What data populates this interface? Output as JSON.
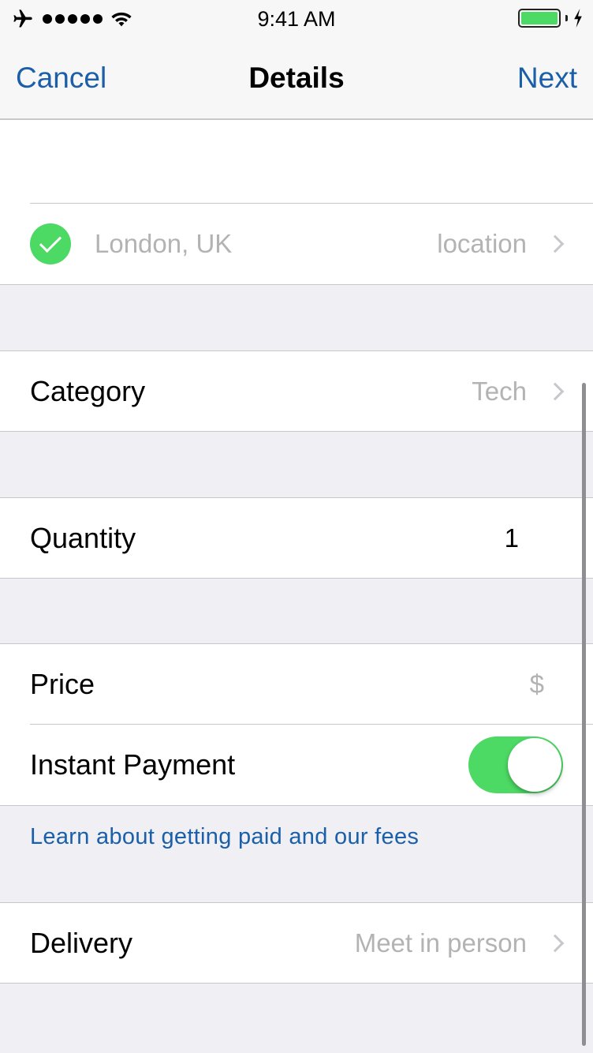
{
  "status_bar": {
    "time": "9:41 AM",
    "left_icons": [
      "airplane-icon",
      "signal-dots-icon",
      "wifi-icon"
    ],
    "right_icons": [
      "battery-icon",
      "charging-bolt-icon"
    ],
    "battery_level": 1.0,
    "battery_color": "#4cd964"
  },
  "nav": {
    "cancel_label": "Cancel",
    "title": "Details",
    "next_label": "Next",
    "accent_color": "#1a5fa8"
  },
  "location": {
    "text": "London, UK",
    "action_label": "location",
    "verified": true
  },
  "category": {
    "label": "Category",
    "value": "Tech"
  },
  "quantity": {
    "label": "Quantity",
    "value": "1"
  },
  "price": {
    "label": "Price",
    "placeholder": "$"
  },
  "instant_payment": {
    "label": "Instant Payment",
    "enabled": true
  },
  "fees_link": "Learn about getting paid and our fees",
  "delivery": {
    "label": "Delivery",
    "value": "Meet in person"
  }
}
